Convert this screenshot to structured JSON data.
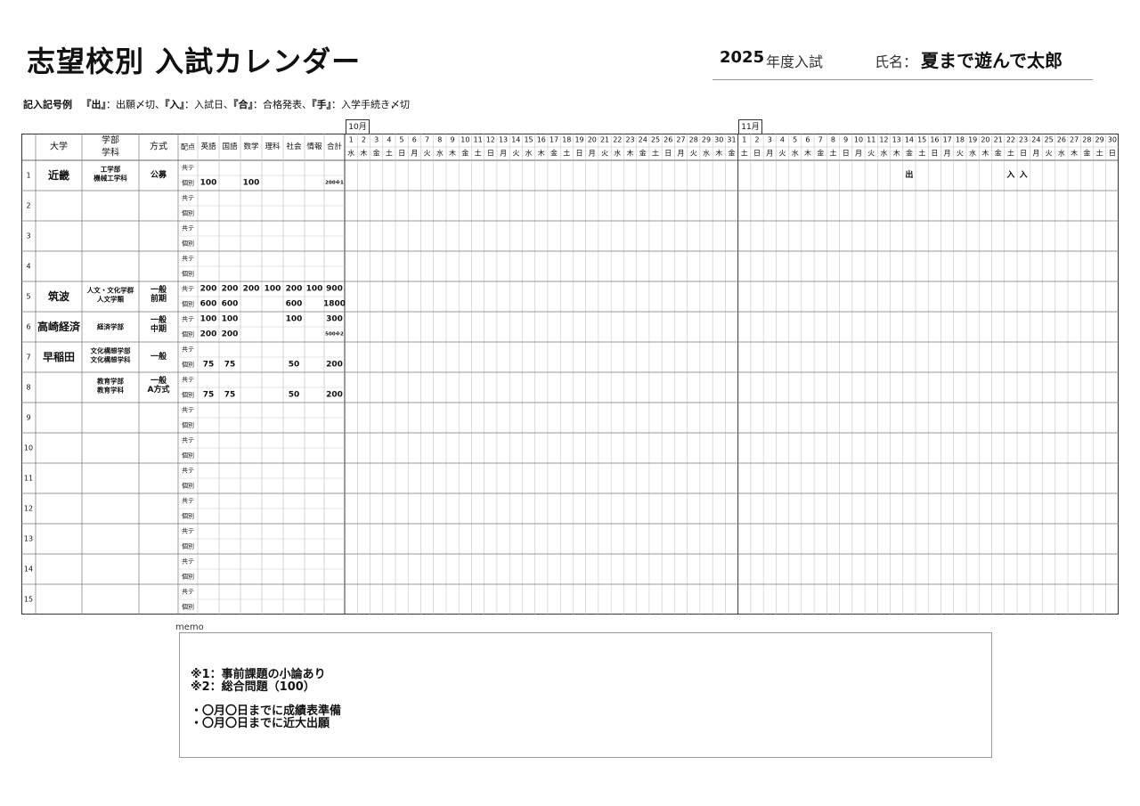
{
  "header": {
    "title": "志望校別 入試カレンダー",
    "year": "2025",
    "year_label": "年度入試",
    "name_label": "氏名：",
    "name_value": "夏まで遊んで太郎"
  },
  "legend": {
    "prefix": "記入記号例",
    "items": [
      {
        "mark": "『出』",
        "desc": "：出願〆切、"
      },
      {
        "mark": "『入』",
        "desc": "：入試日、"
      },
      {
        "mark": "『合』",
        "desc": "：合格発表、"
      },
      {
        "mark": "『手』",
        "desc": "：入学手続き〆切"
      }
    ]
  },
  "table": {
    "headers": {
      "daigaku": "大学",
      "gakubu_1": "学部",
      "gakubu_2": "学科",
      "houshiki": "方式",
      "haiten": "配点"
    },
    "subjects": [
      "英語",
      "国語",
      "数学",
      "理科",
      "社会",
      "情報",
      "合計"
    ],
    "sub_labels": [
      "共テ",
      "個別"
    ],
    "rows": [
      {
        "no": "1",
        "univ": "近畿",
        "dept": [
          "工学部",
          "機械工学科"
        ],
        "method": [
          "公募"
        ],
        "kyote": [
          "",
          "",
          "",
          "",
          "",
          "",
          ""
        ],
        "kobetsu": [
          "100",
          "",
          "100",
          "",
          "",
          "",
          "200※1"
        ]
      },
      {
        "no": "2",
        "univ": "",
        "dept": [],
        "method": [],
        "kyote": [
          "",
          "",
          "",
          "",
          "",
          "",
          ""
        ],
        "kobetsu": [
          "",
          "",
          "",
          "",
          "",
          "",
          ""
        ]
      },
      {
        "no": "3",
        "univ": "",
        "dept": [],
        "method": [],
        "kyote": [
          "",
          "",
          "",
          "",
          "",
          "",
          ""
        ],
        "kobetsu": [
          "",
          "",
          "",
          "",
          "",
          "",
          ""
        ]
      },
      {
        "no": "4",
        "univ": "",
        "dept": [],
        "method": [],
        "kyote": [
          "",
          "",
          "",
          "",
          "",
          "",
          ""
        ],
        "kobetsu": [
          "",
          "",
          "",
          "",
          "",
          "",
          ""
        ]
      },
      {
        "no": "5",
        "univ": "筑波",
        "dept": [
          "人文・文化学群",
          "人文学類"
        ],
        "method": [
          "一般",
          "前期"
        ],
        "kyote": [
          "200",
          "200",
          "200",
          "100",
          "200",
          "100",
          "900"
        ],
        "kobetsu": [
          "600",
          "600",
          "",
          "",
          "600",
          "",
          "1800"
        ]
      },
      {
        "no": "6",
        "univ": "高崎経済",
        "dept": [
          "経済学部"
        ],
        "method": [
          "一般",
          "中期"
        ],
        "kyote": [
          "100",
          "100",
          "",
          "",
          "100",
          "",
          "300"
        ],
        "kobetsu": [
          "200",
          "200",
          "",
          "",
          "",
          "",
          "500※2"
        ]
      },
      {
        "no": "7",
        "univ": "早稲田",
        "dept": [
          "文化構想学部",
          "文化構想学科"
        ],
        "method": [
          "一般"
        ],
        "kyote": [
          "",
          "",
          "",
          "",
          "",
          "",
          ""
        ],
        "kobetsu": [
          "75",
          "75",
          "",
          "",
          "50",
          "",
          "200"
        ]
      },
      {
        "no": "8",
        "univ": "",
        "dept": [
          "教育学部",
          "教育学科"
        ],
        "method": [
          "一般",
          "A方式"
        ],
        "kyote": [
          "",
          "",
          "",
          "",
          "",
          "",
          ""
        ],
        "kobetsu": [
          "75",
          "75",
          "",
          "",
          "50",
          "",
          "200"
        ]
      },
      {
        "no": "9",
        "univ": "",
        "dept": [],
        "method": [],
        "kyote": [
          "",
          "",
          "",
          "",
          "",
          "",
          ""
        ],
        "kobetsu": [
          "",
          "",
          "",
          "",
          "",
          "",
          ""
        ]
      },
      {
        "no": "10",
        "univ": "",
        "dept": [],
        "method": [],
        "kyote": [
          "",
          "",
          "",
          "",
          "",
          "",
          ""
        ],
        "kobetsu": [
          "",
          "",
          "",
          "",
          "",
          "",
          ""
        ]
      },
      {
        "no": "11",
        "univ": "",
        "dept": [],
        "method": [],
        "kyote": [
          "",
          "",
          "",
          "",
          "",
          "",
          ""
        ],
        "kobetsu": [
          "",
          "",
          "",
          "",
          "",
          "",
          ""
        ]
      },
      {
        "no": "12",
        "univ": "",
        "dept": [],
        "method": [],
        "kyote": [
          "",
          "",
          "",
          "",
          "",
          "",
          ""
        ],
        "kobetsu": [
          "",
          "",
          "",
          "",
          "",
          "",
          ""
        ]
      },
      {
        "no": "13",
        "univ": "",
        "dept": [],
        "method": [],
        "kyote": [
          "",
          "",
          "",
          "",
          "",
          "",
          ""
        ],
        "kobetsu": [
          "",
          "",
          "",
          "",
          "",
          "",
          ""
        ]
      },
      {
        "no": "14",
        "univ": "",
        "dept": [],
        "method": [],
        "kyote": [
          "",
          "",
          "",
          "",
          "",
          "",
          ""
        ],
        "kobetsu": [
          "",
          "",
          "",
          "",
          "",
          "",
          ""
        ]
      },
      {
        "no": "15",
        "univ": "",
        "dept": [],
        "method": [],
        "kyote": [
          "",
          "",
          "",
          "",
          "",
          "",
          ""
        ],
        "kobetsu": [
          "",
          "",
          "",
          "",
          "",
          "",
          ""
        ]
      }
    ]
  },
  "calendar": {
    "months": [
      {
        "label": "10月",
        "days": 31,
        "weekdays": [
          "水",
          "木",
          "金",
          "土",
          "日",
          "月",
          "火",
          "水",
          "木",
          "金",
          "土",
          "日",
          "月",
          "火",
          "水",
          "木",
          "金",
          "土",
          "日",
          "月",
          "火",
          "水",
          "木",
          "金",
          "土",
          "日",
          "月",
          "火",
          "水",
          "木",
          "金"
        ]
      },
      {
        "label": "11月",
        "days": 30,
        "weekdays": [
          "土",
          "日",
          "月",
          "火",
          "水",
          "木",
          "金",
          "土",
          "日",
          "月",
          "火",
          "水",
          "木",
          "金",
          "土",
          "日",
          "月",
          "火",
          "水",
          "木",
          "金",
          "土",
          "日",
          "月",
          "火",
          "水",
          "木",
          "金",
          "土",
          "日"
        ]
      }
    ],
    "marks": [
      {
        "row": 1,
        "month": 1,
        "day": 14,
        "text": "出"
      },
      {
        "row": 1,
        "month": 1,
        "day": 22,
        "text": "入"
      },
      {
        "row": 1,
        "month": 1,
        "day": 23,
        "text": "入"
      }
    ]
  },
  "memo": {
    "label": "memo",
    "lines": [
      "※1：事前課題の小論あり",
      "※2：総合問題（100）",
      "・〇月〇日までに成績表準備",
      "・〇月〇日までに近大出願"
    ]
  }
}
